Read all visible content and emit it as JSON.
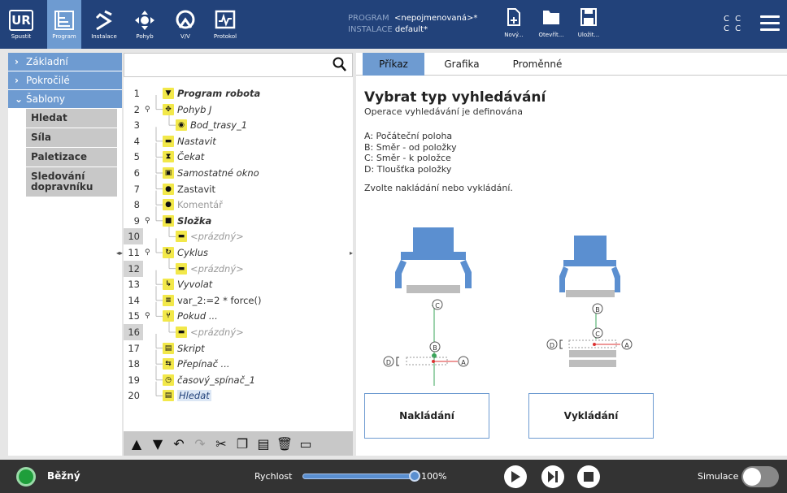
{
  "header": {
    "nav": [
      {
        "id": "spustit",
        "label": "Spustit",
        "icon": "ur-logo"
      },
      {
        "id": "program",
        "label": "Program",
        "icon": "program-icon",
        "active": true
      },
      {
        "id": "instalace",
        "label": "Instalace",
        "icon": "install-icon"
      },
      {
        "id": "pohyb",
        "label": "Pohyb",
        "icon": "move-icon"
      },
      {
        "id": "vv",
        "label": "V/V",
        "icon": "io-icon"
      },
      {
        "id": "protokol",
        "label": "Protokol",
        "icon": "log-icon"
      }
    ],
    "program_label": "PROGRAM",
    "program_value": "<nepojmenovaná>*",
    "install_label": "INSTALACE",
    "install_value": "default*",
    "file_buttons": [
      {
        "label": "Nový...",
        "icon": "new-file-icon"
      },
      {
        "label": "Otevřít...",
        "icon": "folder-icon"
      },
      {
        "label": "Uložit...",
        "icon": "save-icon"
      }
    ],
    "cc_top": "C C",
    "cc_bottom": "C C"
  },
  "left_panel": {
    "categories": [
      {
        "label": "Základní",
        "expanded": false
      },
      {
        "label": "Pokročilé",
        "expanded": false
      },
      {
        "label": "Šablony",
        "expanded": true
      }
    ],
    "templates": [
      "Hledat",
      "Síla",
      "Paletizace",
      "Sledování dopravníku"
    ]
  },
  "tree": {
    "search_placeholder": "",
    "rows": [
      {
        "num": "1",
        "label": "Program robota",
        "icon": "▼",
        "indent": 0,
        "style": "bold-it",
        "pin": false,
        "grey": false
      },
      {
        "num": "2",
        "label": "Pohyb J",
        "icon": "✥",
        "indent": 0,
        "style": "it",
        "pin": true,
        "grey": false
      },
      {
        "num": "3",
        "label": "Bod_trasy_1",
        "icon": "◉",
        "indent": 1,
        "style": "it",
        "pin": false,
        "grey": false
      },
      {
        "num": "4",
        "label": "Nastavit",
        "icon": "▬",
        "indent": 0,
        "style": "it",
        "pin": false,
        "grey": false
      },
      {
        "num": "5",
        "label": "Čekat",
        "icon": "⧗",
        "indent": 0,
        "style": "it",
        "pin": false,
        "grey": false
      },
      {
        "num": "6",
        "label": "Samostatné okno",
        "icon": "▣",
        "indent": 0,
        "style": "it",
        "pin": false,
        "grey": false
      },
      {
        "num": "7",
        "label": "Zastavit",
        "icon": "●",
        "indent": 0,
        "style": "",
        "pin": false,
        "grey": false
      },
      {
        "num": "8",
        "label": "Komentář",
        "icon": "●",
        "indent": 0,
        "style": "muted",
        "pin": false,
        "grey": false
      },
      {
        "num": "9",
        "label": "Složka",
        "icon": "■",
        "indent": 0,
        "style": "bold-it",
        "pin": true,
        "grey": false
      },
      {
        "num": "10",
        "label": "<prázdný>",
        "icon": "▬",
        "indent": 1,
        "style": "muted-it",
        "pin": false,
        "grey": true
      },
      {
        "num": "11",
        "label": "Cyklus",
        "icon": "↻",
        "indent": 0,
        "style": "it",
        "pin": true,
        "grey": false
      },
      {
        "num": "12",
        "label": "<prázdný>",
        "icon": "▬",
        "indent": 1,
        "style": "muted-it",
        "pin": false,
        "grey": true
      },
      {
        "num": "13",
        "label": "Vyvolat",
        "icon": "↳",
        "indent": 0,
        "style": "it",
        "pin": false,
        "grey": false
      },
      {
        "num": "14",
        "label": "var_2:=2 * force()",
        "icon": "≡",
        "indent": 0,
        "style": "",
        "pin": false,
        "grey": false
      },
      {
        "num": "15",
        "label": "Pokud ...",
        "icon": "⑂",
        "indent": 0,
        "style": "it",
        "pin": true,
        "grey": false
      },
      {
        "num": "16",
        "label": "<prázdný>",
        "icon": "▬",
        "indent": 1,
        "style": "muted-it",
        "pin": false,
        "grey": true
      },
      {
        "num": "17",
        "label": "Skript",
        "icon": "▤",
        "indent": 0,
        "style": "it",
        "pin": false,
        "grey": false
      },
      {
        "num": "18",
        "label": "Přepínač ...",
        "icon": "⇆",
        "indent": 0,
        "style": "it",
        "pin": false,
        "grey": false
      },
      {
        "num": "19",
        "label": "časový_spínač_1",
        "icon": "◷",
        "indent": 0,
        "style": "it",
        "pin": false,
        "grey": false
      },
      {
        "num": "20",
        "label": "Hledat",
        "icon": "▤",
        "indent": 0,
        "style": "sel",
        "pin": false,
        "grey": false
      }
    ],
    "toolbar": [
      {
        "name": "move-up-icon",
        "glyph": "▲",
        "disabled": false
      },
      {
        "name": "move-down-icon",
        "glyph": "▼",
        "disabled": false
      },
      {
        "name": "undo-icon",
        "glyph": "↶",
        "disabled": false
      },
      {
        "name": "redo-icon",
        "glyph": "↷",
        "disabled": true
      },
      {
        "name": "cut-icon",
        "glyph": "✂",
        "disabled": false
      },
      {
        "name": "copy-icon",
        "glyph": "❐",
        "disabled": false
      },
      {
        "name": "paste-icon",
        "glyph": "▤",
        "disabled": false
      },
      {
        "name": "delete-icon",
        "glyph": "🗑",
        "disabled": false
      },
      {
        "name": "suppress-icon",
        "glyph": "▭",
        "disabled": false
      }
    ]
  },
  "right_panel": {
    "tabs": [
      "Příkaz",
      "Grafika",
      "Proměnné"
    ],
    "active_tab": "Příkaz",
    "title": "Vybrat typ vyhledávání",
    "subtitle": "Operace vyhledávání je definována",
    "options": [
      "A: Počáteční poloha",
      "B: Směr - od položky",
      "C: Směr - k položce",
      "D: Tloušťka položky"
    ],
    "instruction": "Zvolte nakládání nebo vykládání.",
    "diagram_labels": {
      "a": "A",
      "b": "B",
      "c": "C",
      "d": "D"
    },
    "button_stack": "Nakládání",
    "button_destack": "Vykládání"
  },
  "footer": {
    "status": "Běžný",
    "speed_label": "Rychlost",
    "speed_value": "100%",
    "speed_fraction": 1.0,
    "sim_label": "Simulace",
    "colors": {
      "status": "#1f9e3b",
      "accent": "#5a8fd0"
    }
  }
}
